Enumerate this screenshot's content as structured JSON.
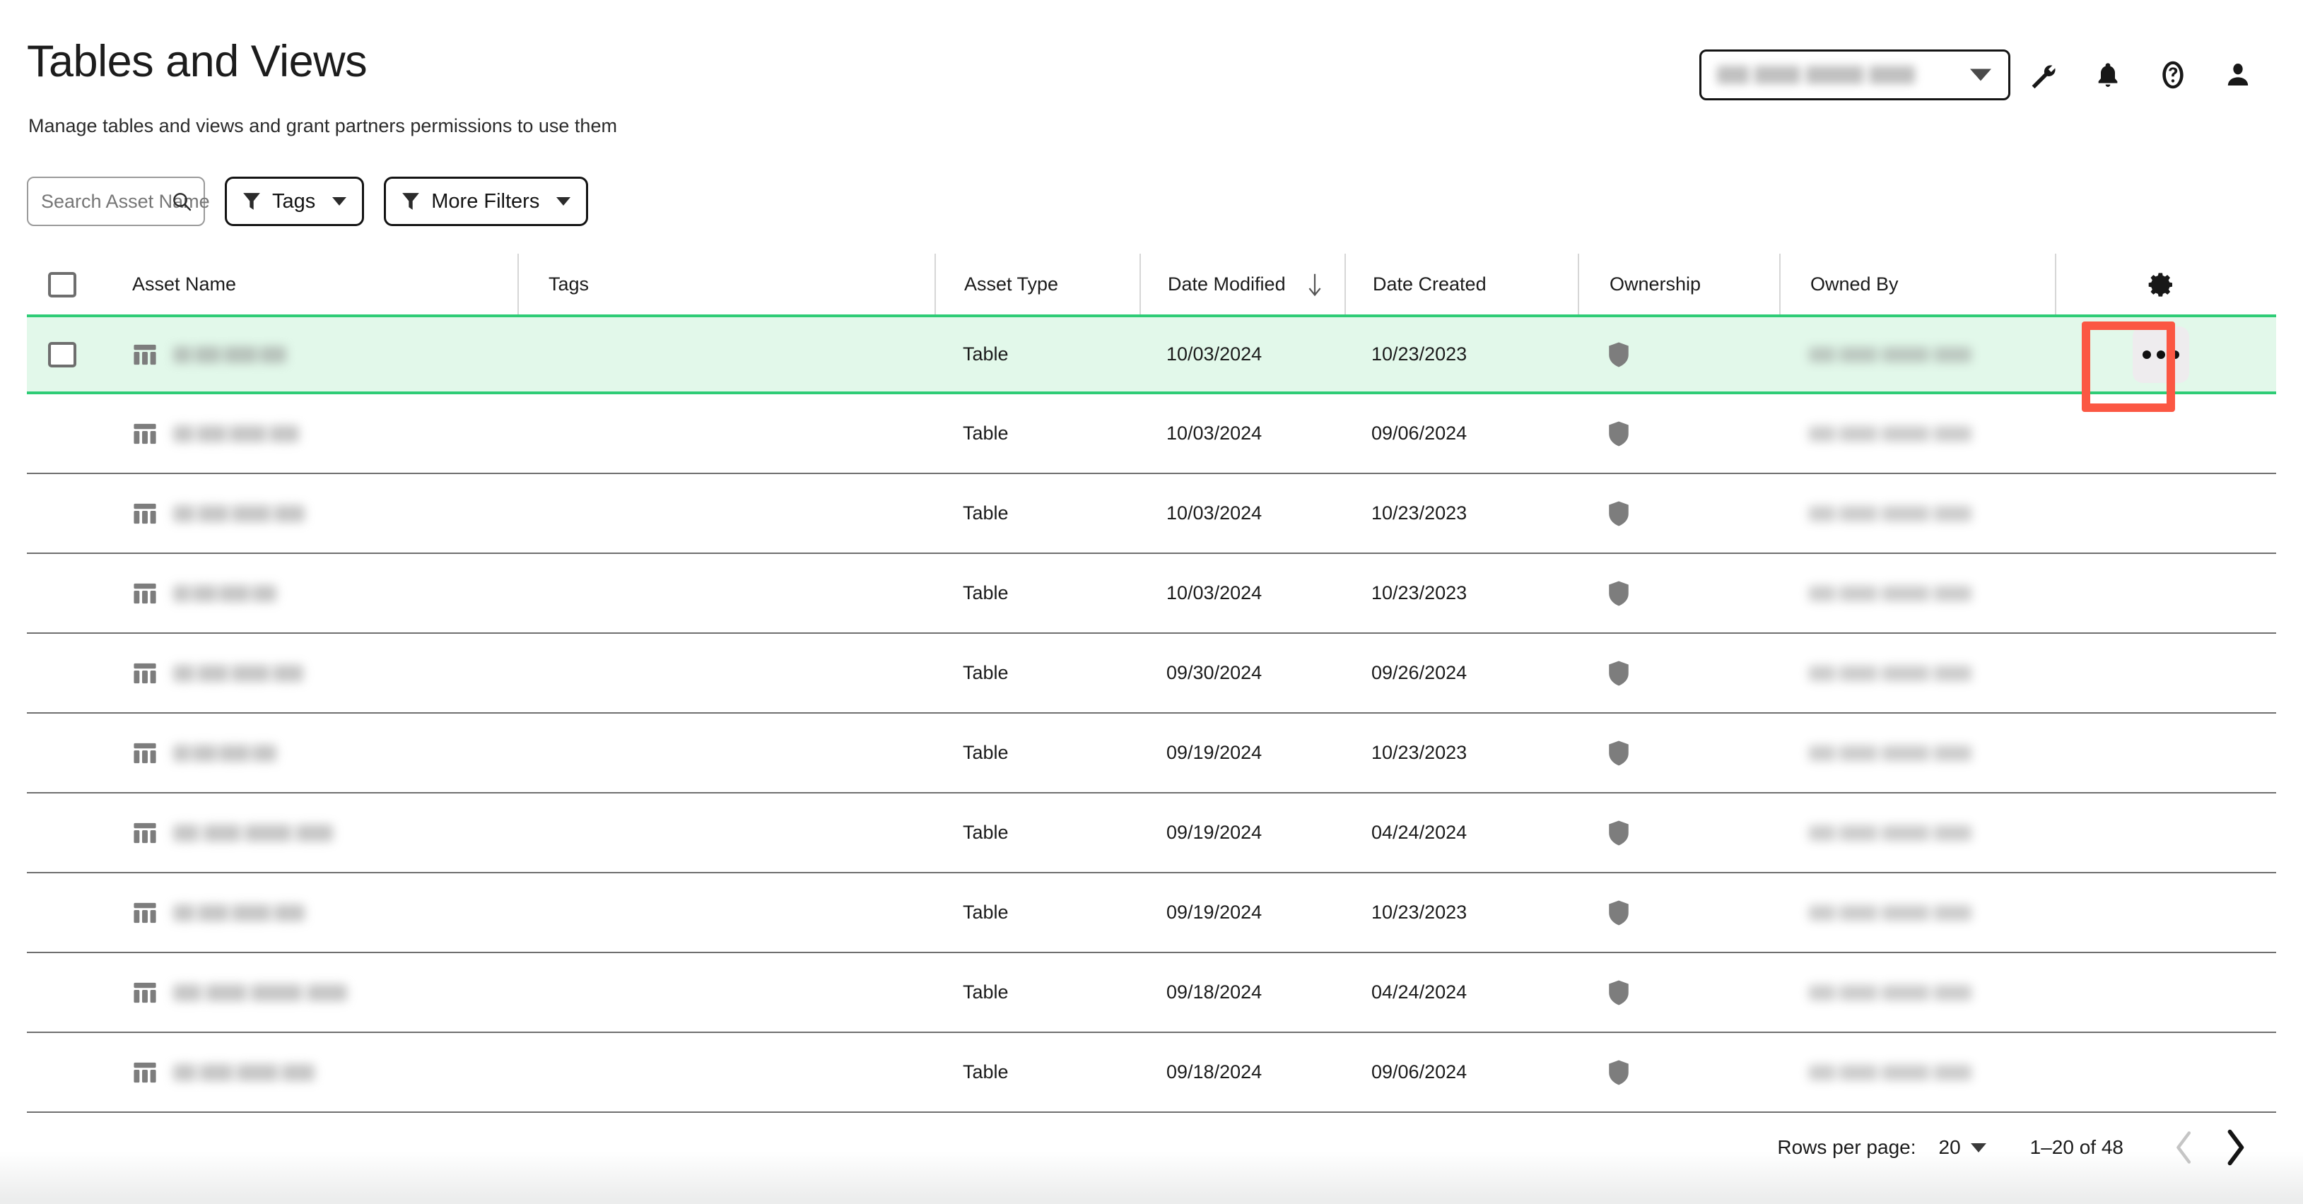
{
  "header": {
    "title": "Tables and Views",
    "subtitle": "Manage tables and views and grant partners permissions to use them",
    "org_selector": {
      "value": "",
      "redacted": true,
      "caret": "chevron-down-icon"
    },
    "icons": [
      "wrench-icon",
      "bell-icon",
      "help-circle-icon",
      "user-account-icon"
    ]
  },
  "toolbar": {
    "search": {
      "placeholder": "Search Asset Name",
      "value": "",
      "icon": "search-icon"
    },
    "tags_button": {
      "label": "Tags",
      "icon": "filter-funnel-icon",
      "caret": "chevron-down-icon"
    },
    "more_filters_button": {
      "label": "More Filters",
      "icon": "filter-funnel-icon",
      "caret": "chevron-down-icon"
    }
  },
  "table": {
    "columns": [
      {
        "key": "select",
        "label": ""
      },
      {
        "key": "asset_name",
        "label": "Asset Name"
      },
      {
        "key": "tags",
        "label": "Tags"
      },
      {
        "key": "asset_type",
        "label": "Asset Type"
      },
      {
        "key": "date_modified",
        "label": "Date Modified",
        "sorted": "desc",
        "sort_icon": "arrow-down-icon"
      },
      {
        "key": "date_created",
        "label": "Date Created"
      },
      {
        "key": "ownership",
        "label": "Ownership"
      },
      {
        "key": "owned_by",
        "label": "Owned By"
      },
      {
        "key": "actions",
        "label": ""
      }
    ],
    "settings_icon": "gear-icon",
    "header_checkbox_checked": false,
    "rows": [
      {
        "selected": true,
        "name_redacted": true,
        "name_width": 160,
        "tags": "",
        "asset_type": "Table",
        "date_modified": "10/03/2024",
        "date_created": "10/23/2023",
        "ownership_icon": "shield-icon",
        "owned_by_redacted": true,
        "action_icon": "more-options-icon"
      },
      {
        "selected": false,
        "name_redacted": true,
        "name_width": 178,
        "tags": "",
        "asset_type": "Table",
        "date_modified": "10/03/2024",
        "date_created": "09/06/2024",
        "ownership_icon": "shield-icon",
        "owned_by_redacted": true,
        "action_icon": "more-options-icon"
      },
      {
        "selected": false,
        "name_redacted": true,
        "name_width": 186,
        "tags": "",
        "asset_type": "Table",
        "date_modified": "10/03/2024",
        "date_created": "10/23/2023",
        "ownership_icon": "shield-icon",
        "owned_by_redacted": true,
        "action_icon": "more-options-icon"
      },
      {
        "selected": false,
        "name_redacted": true,
        "name_width": 146,
        "tags": "",
        "asset_type": "Table",
        "date_modified": "10/03/2024",
        "date_created": "10/23/2023",
        "ownership_icon": "shield-icon",
        "owned_by_redacted": true,
        "action_icon": "more-options-icon"
      },
      {
        "selected": false,
        "name_redacted": true,
        "name_width": 184,
        "tags": "",
        "asset_type": "Table",
        "date_modified": "09/30/2024",
        "date_created": "09/26/2024",
        "ownership_icon": "shield-icon",
        "owned_by_redacted": true,
        "action_icon": "more-options-icon"
      },
      {
        "selected": false,
        "name_redacted": true,
        "name_width": 146,
        "tags": "",
        "asset_type": "Table",
        "date_modified": "09/19/2024",
        "date_created": "10/23/2023",
        "ownership_icon": "shield-icon",
        "owned_by_redacted": true,
        "action_icon": "more-options-icon"
      },
      {
        "selected": false,
        "name_redacted": true,
        "name_width": 226,
        "tags": "",
        "asset_type": "Table",
        "date_modified": "09/19/2024",
        "date_created": "04/24/2024",
        "ownership_icon": "shield-icon",
        "owned_by_redacted": true,
        "action_icon": "more-options-icon"
      },
      {
        "selected": false,
        "name_redacted": true,
        "name_width": 186,
        "tags": "",
        "asset_type": "Table",
        "date_modified": "09/19/2024",
        "date_created": "10/23/2023",
        "ownership_icon": "shield-icon",
        "owned_by_redacted": true,
        "action_icon": "more-options-icon"
      },
      {
        "selected": false,
        "name_redacted": true,
        "name_width": 246,
        "tags": "",
        "asset_type": "Table",
        "date_modified": "09/18/2024",
        "date_created": "04/24/2024",
        "ownership_icon": "shield-icon",
        "owned_by_redacted": true,
        "action_icon": "more-options-icon"
      },
      {
        "selected": false,
        "name_redacted": true,
        "name_width": 200,
        "tags": "",
        "asset_type": "Table",
        "date_modified": "09/18/2024",
        "date_created": "09/06/2024",
        "ownership_icon": "shield-icon",
        "owned_by_redacted": true,
        "action_icon": "more-options-icon"
      }
    ]
  },
  "pagination": {
    "rows_per_page_label": "Rows per page:",
    "rows_per_page_value": "20",
    "range_label": "1–20 of 48",
    "prev_icon": "chevron-left-icon",
    "next_icon": "chevron-right-icon",
    "prev_disabled": true,
    "next_disabled": false
  },
  "highlight": {
    "target": "more-options-icon",
    "color": "#fb5743"
  },
  "colors": {
    "selected_row_bg": "#e2f8ea",
    "selected_row_border": "#2ecc76",
    "highlight": "#fb5743",
    "text": "#1b1b1b",
    "divider": "#6f6f6f"
  }
}
